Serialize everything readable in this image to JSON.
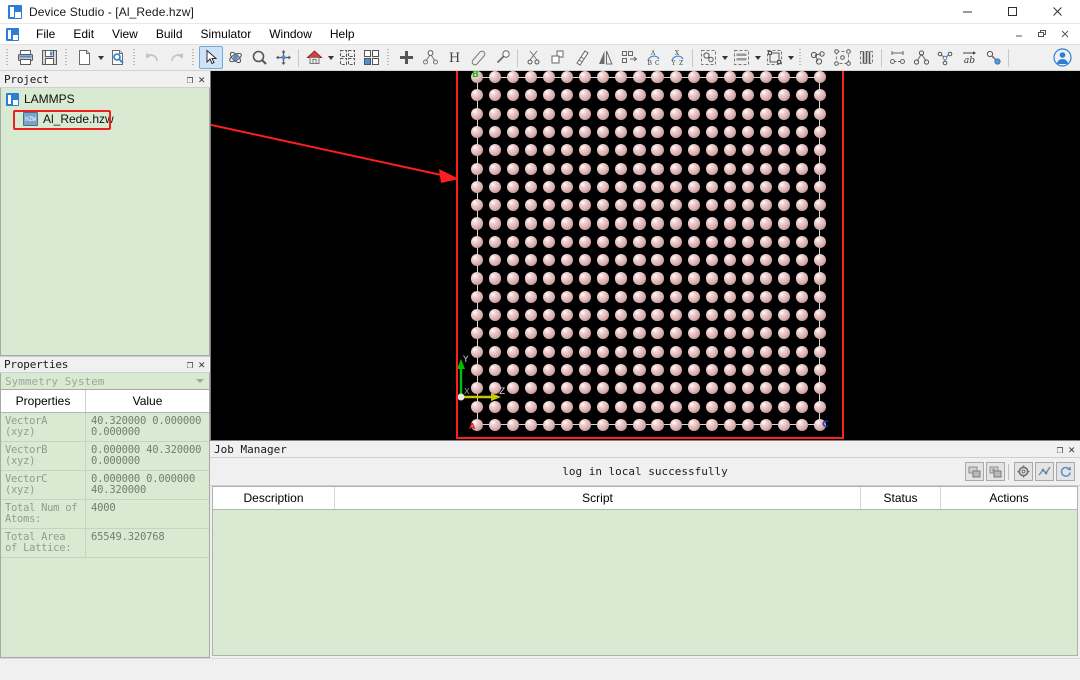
{
  "window": {
    "title": "Device Studio - [Al_Rede.hzw]",
    "app_icon": "app-logo-icon",
    "minimize": "—",
    "maximize": "□",
    "close": "✕",
    "mdi_minimize": "–",
    "mdi_restore": "❐",
    "mdi_close": "✕"
  },
  "menu": {
    "items": [
      {
        "label": "File"
      },
      {
        "label": "Edit"
      },
      {
        "label": "View"
      },
      {
        "label": "Build"
      },
      {
        "label": "Simulator"
      },
      {
        "label": "Window"
      },
      {
        "label": "Help"
      }
    ]
  },
  "toolbar": {
    "groups": [
      {
        "buttons": [
          {
            "name": "print-icon",
            "label": "Print"
          },
          {
            "name": "save-icon",
            "label": "Save"
          }
        ]
      },
      {
        "buttons": [
          {
            "name": "new-file-icon",
            "label": "New",
            "dropdown": true
          },
          {
            "name": "open-file-icon",
            "label": "Open"
          }
        ]
      },
      {
        "buttons": [
          {
            "name": "undo-icon",
            "label": "Undo",
            "disabled": true
          },
          {
            "name": "redo-icon",
            "label": "Redo",
            "disabled": true
          }
        ]
      },
      {
        "buttons": [
          {
            "name": "select-arrow-icon",
            "label": "Select",
            "active": true
          },
          {
            "name": "rotate-icon",
            "label": "Rotate"
          },
          {
            "name": "zoom-icon",
            "label": "Zoom"
          },
          {
            "name": "pan-icon",
            "label": "Pan"
          }
        ]
      },
      {
        "buttons": [
          {
            "name": "home-view-icon",
            "label": "Home View",
            "dropdown": true
          },
          {
            "name": "fit-view-icon",
            "label": "Fit to View"
          },
          {
            "name": "layout-view-icon",
            "label": "Layout"
          }
        ]
      },
      {
        "buttons": [
          {
            "name": "add-atom-icon",
            "label": "Add Atom"
          },
          {
            "name": "add-bond-icon",
            "label": "Add Bond"
          },
          {
            "name": "hydrogen-icon",
            "label": "Hydrogen"
          },
          {
            "name": "eraser-icon",
            "label": "Eraser"
          },
          {
            "name": "dropper-icon",
            "label": "Dropper"
          }
        ]
      },
      {
        "buttons": [
          {
            "name": "cut-icon",
            "label": "Cut"
          },
          {
            "name": "copy-icon",
            "label": "Copy"
          },
          {
            "name": "measure-icon",
            "label": "Measure"
          },
          {
            "name": "mirror-icon",
            "label": "Mirror"
          },
          {
            "name": "transform-icon",
            "label": "Transform"
          },
          {
            "name": "abc-rotate-icon",
            "label": "ABC Rotate"
          },
          {
            "name": "xyz-rotate-icon",
            "label": "XYZ Rotate"
          }
        ]
      },
      {
        "buttons": [
          {
            "name": "cluster-icon",
            "label": "Cluster",
            "dropdown": true
          },
          {
            "name": "slab-icon",
            "label": "Slab",
            "dropdown": true
          },
          {
            "name": "supercell-icon",
            "label": "Supercell",
            "dropdown": true
          }
        ]
      },
      {
        "buttons": [
          {
            "name": "molecule-icon",
            "label": "Molecule"
          },
          {
            "name": "crystal-icon",
            "label": "Crystal"
          },
          {
            "name": "nanotube-icon",
            "label": "Nanotube"
          }
        ]
      },
      {
        "buttons": [
          {
            "name": "distance-icon",
            "label": "Distance"
          },
          {
            "name": "angle-icon",
            "label": "Angle"
          },
          {
            "name": "dihedral-icon",
            "label": "Dihedral"
          },
          {
            "name": "label-ab-icon",
            "label": "Label"
          },
          {
            "name": "bond-length-icon",
            "label": "Bond Length"
          }
        ]
      },
      {
        "buttons": [
          {
            "name": "user-account-icon",
            "label": "Account"
          }
        ]
      }
    ]
  },
  "project_panel": {
    "title": "Project",
    "float_icon": "float-icon",
    "close_icon": "close-icon",
    "root": {
      "label": "LAMMPS",
      "icon": "lammps-project-icon"
    },
    "child": {
      "label": "Al_Rede.hzw",
      "icon": "hzw-file-icon"
    }
  },
  "properties_panel": {
    "title": "Properties",
    "float_icon": "float-icon",
    "close_icon": "close-icon",
    "selector_value": "Symmetry System",
    "columns": [
      "Properties",
      "Value"
    ],
    "rows": [
      {
        "property": "VectorA (xyz)",
        "value": "40.320000  0.000000\n0.000000"
      },
      {
        "property": "VectorB (xyz)",
        "value": "0.000000  40.320000\n0.000000"
      },
      {
        "property": "VectorC (xyz)",
        "value": "0.000000  0.000000\n40.320000"
      },
      {
        "property": "Total Num of Atoms:",
        "value": "4000"
      },
      {
        "property": "Total Area of Lattice:",
        "value": "65549.320768"
      }
    ]
  },
  "viewport": {
    "background_color": "#000000",
    "atom_color": "#e0bcbc",
    "cell_box_color": "#d6d6d6",
    "axis": {
      "x_label": "X",
      "x_color": "#bdbdbd",
      "y_label": "Y",
      "y_color": "#00c000",
      "z_label": "Z",
      "z_color": "#c8c800"
    },
    "cell_labels": {
      "a": {
        "text": "A",
        "color": "#d02020"
      },
      "b": {
        "text": "B",
        "color": "#20b020"
      },
      "c": {
        "text": "C",
        "color": "#2040d0"
      }
    },
    "lattice": {
      "cols": 20,
      "rows": 20
    },
    "annotation": {
      "rect_color": "#fd1f1f",
      "arrow_color": "#fd1f1f"
    }
  },
  "job_manager": {
    "title": "Job Manager",
    "float_icon": "float-icon",
    "close_icon": "close-icon",
    "status_message": "log in local successfully",
    "tool_buttons": [
      {
        "name": "local-job-icon",
        "label": "Local"
      },
      {
        "name": "remote-job-icon",
        "label": "Remote"
      },
      {
        "name": "settings-gear-icon",
        "label": "Settings"
      },
      {
        "name": "plot-icon",
        "label": "Plot"
      },
      {
        "name": "refresh-icon",
        "label": "Refresh"
      }
    ],
    "columns": [
      "Description",
      "Script",
      "Status",
      "Actions"
    ],
    "rows": []
  }
}
